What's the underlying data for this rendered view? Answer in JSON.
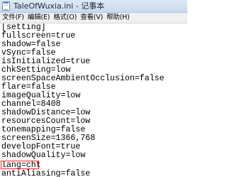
{
  "window": {
    "title": "TaleOfWuxia.ini - 记事本",
    "icon": "notepad-icon"
  },
  "menu": [
    {
      "label": "文件(F)"
    },
    {
      "label": "编辑(E)"
    },
    {
      "label": "格式(O)"
    },
    {
      "label": "查看(V)"
    },
    {
      "label": "帮助(H)"
    }
  ],
  "editor": {
    "lines": [
      "[setting]",
      "fullscreen=true",
      "shadow=false",
      "vSync=false",
      "isInitialized=true",
      "chkSetting=low",
      "screenSpaceAmbientOcclusion=false",
      "flare=false",
      "imageQuality=low",
      "channel=8408",
      "shadowDistance=low",
      "resourcesCount=low",
      "tonemapping=false",
      "screenSize=1366,768",
      "developFont=true",
      "shadowQuality=low",
      "lang=cht",
      "antiAliasing=false"
    ],
    "highlighted_line": "lang=cht",
    "highlight_color": "#e8262b"
  }
}
